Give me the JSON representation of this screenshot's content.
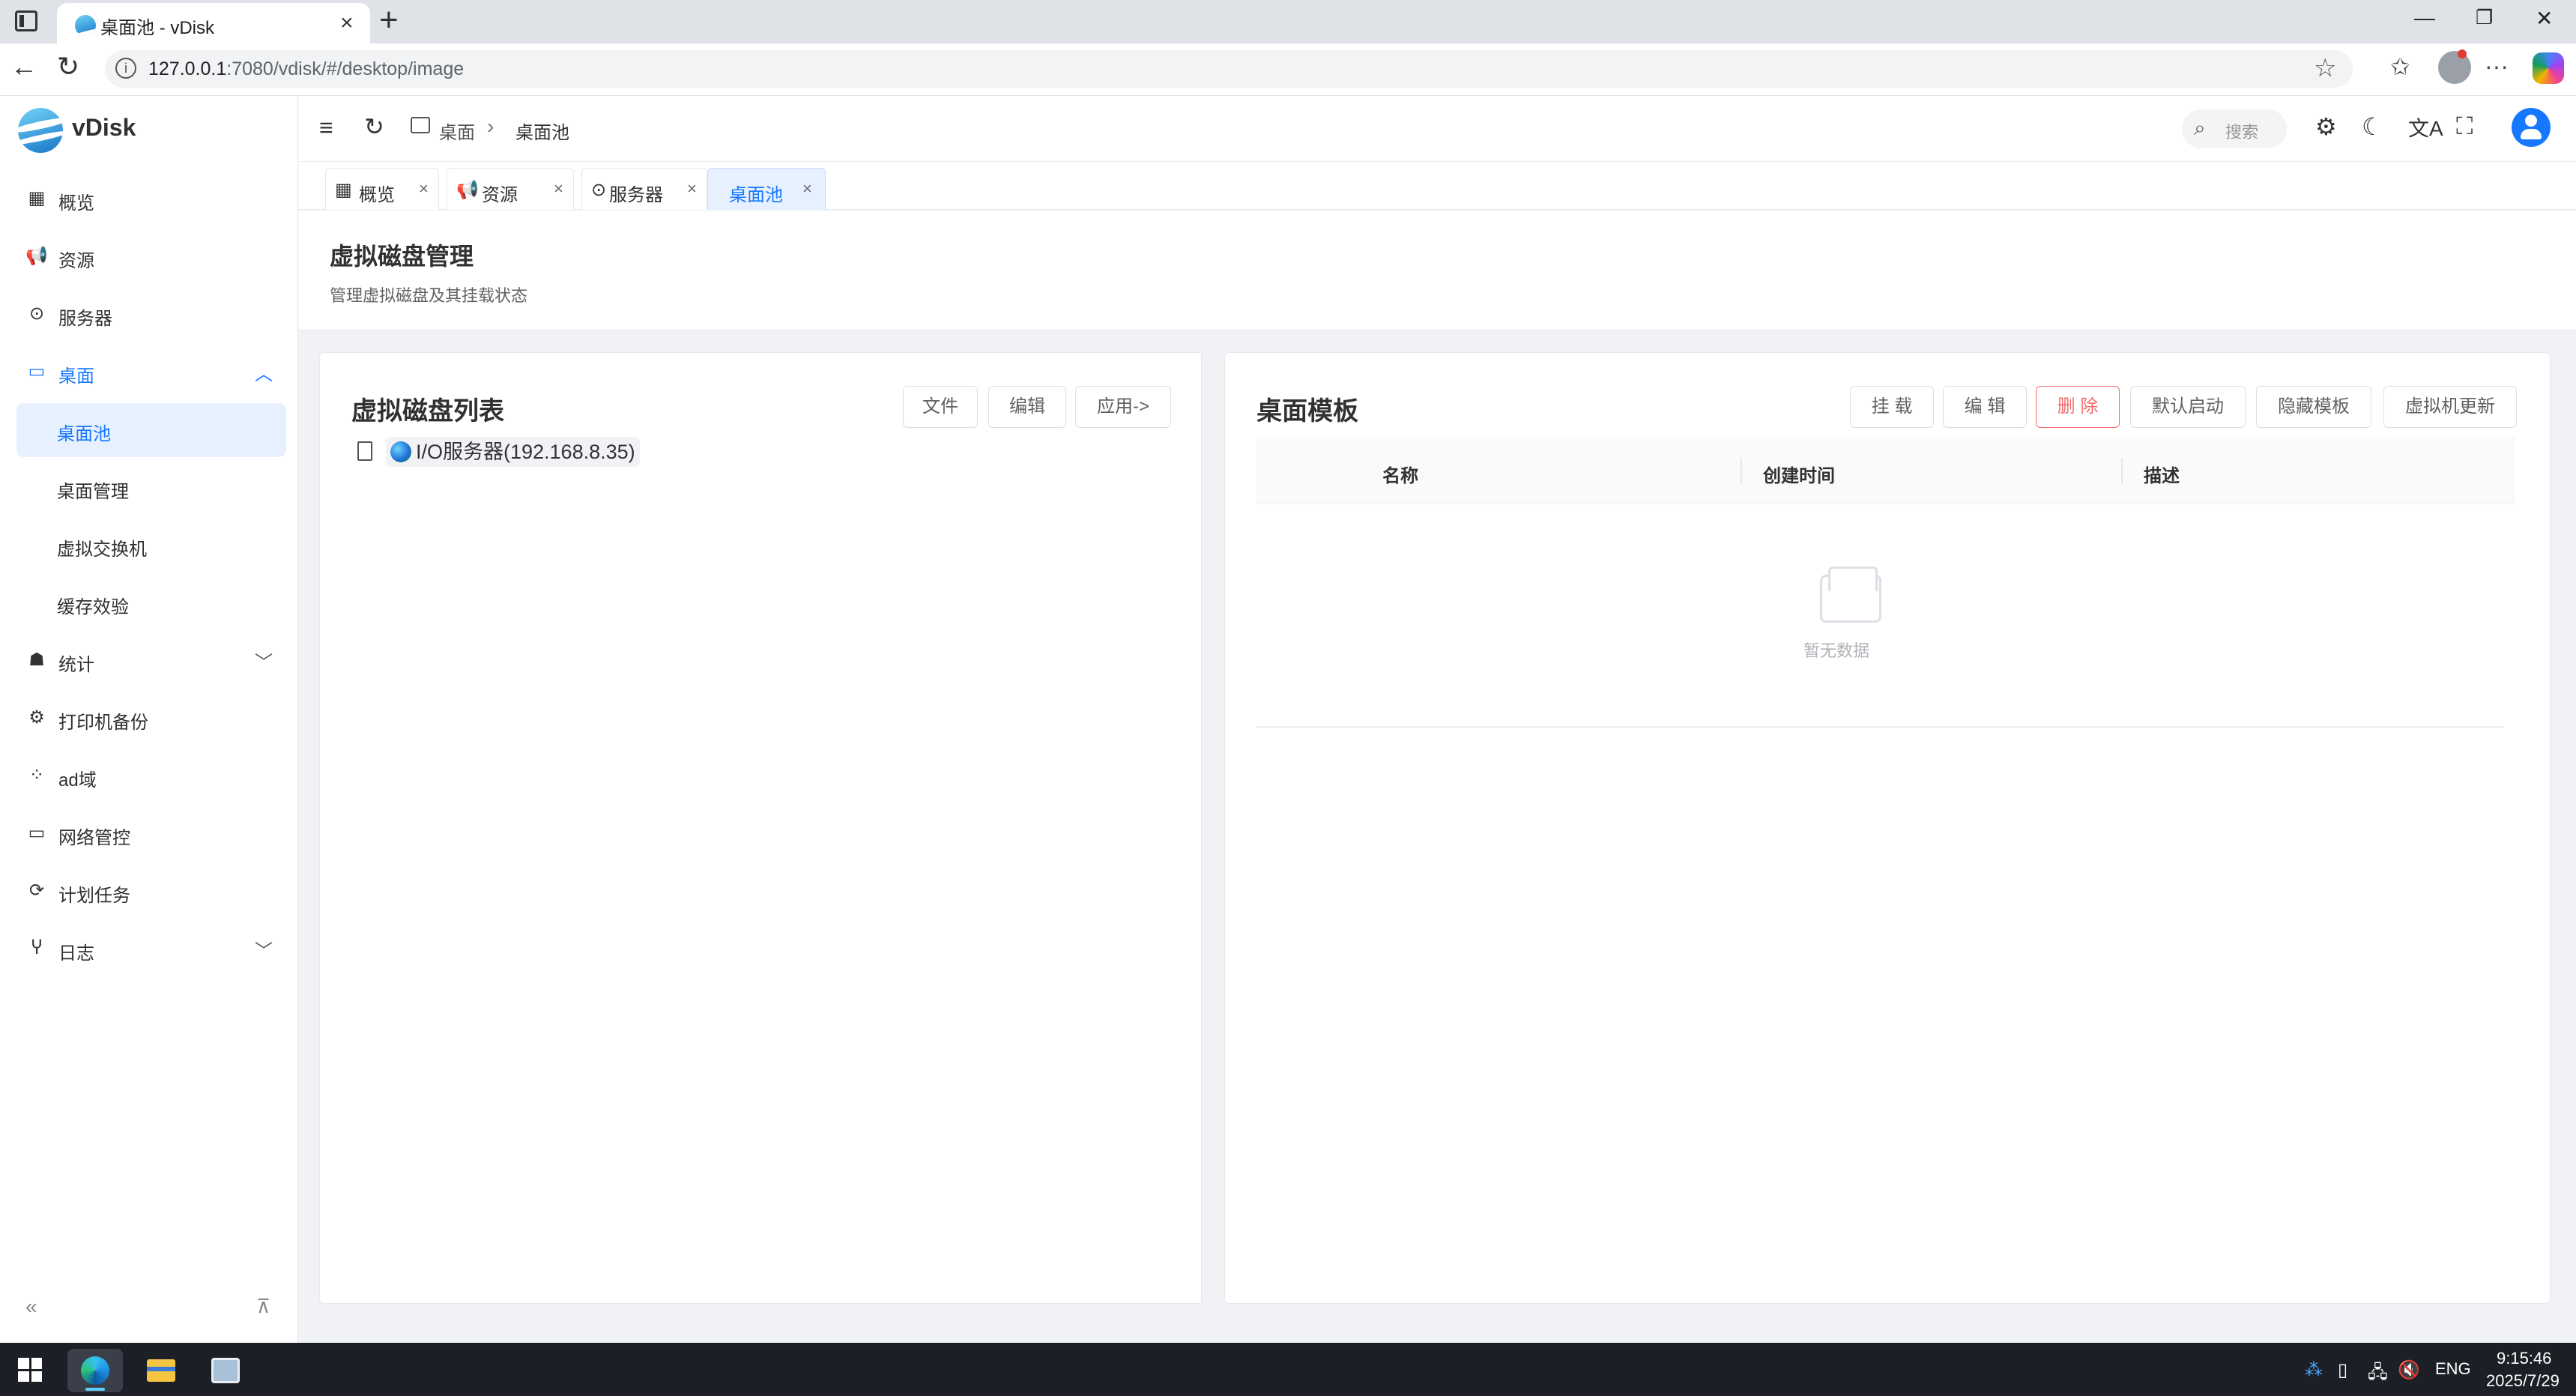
{
  "browser": {
    "tab_title": "桌面池 - vDisk",
    "url_host": "127.0.0.1",
    "url_rest": ":7080/vdisk/#/desktop/image"
  },
  "app": {
    "name": "vDisk"
  },
  "sidebar": {
    "items": [
      {
        "label": "概览",
        "icon": "grid-icon"
      },
      {
        "label": "资源",
        "icon": "megaphone-icon"
      },
      {
        "label": "服务器",
        "icon": "server-icon"
      },
      {
        "label": "桌面",
        "icon": "monitor-icon"
      },
      {
        "label": "桌面池"
      },
      {
        "label": "桌面管理"
      },
      {
        "label": "虚拟交换机"
      },
      {
        "label": "缓存效验"
      },
      {
        "label": "统计",
        "icon": "chart-icon"
      },
      {
        "label": "打印机备份",
        "icon": "gear-icon"
      },
      {
        "label": "ad域",
        "icon": "domain-icon"
      },
      {
        "label": "网络管控",
        "icon": "monitor-icon"
      },
      {
        "label": "计划任务",
        "icon": "task-icon"
      },
      {
        "label": "日志",
        "icon": "log-icon"
      }
    ],
    "footer_collapse": "«",
    "footer_pin": "⊼"
  },
  "topbar": {
    "breadcrumb": [
      "桌面",
      "桌面池"
    ],
    "search_placeholder": "搜索"
  },
  "tabs": [
    {
      "label": "概览",
      "icon": "grid-icon"
    },
    {
      "label": "资源",
      "icon": "megaphone-icon"
    },
    {
      "label": "服务器",
      "icon": "server-icon"
    },
    {
      "label": "桌面池"
    }
  ],
  "page": {
    "title": "虚拟磁盘管理",
    "subtitle": "管理虚拟磁盘及其挂载状态"
  },
  "left_panel": {
    "title": "虚拟磁盘列表",
    "buttons": [
      "文件",
      "编辑",
      "应用->"
    ],
    "tree": [
      {
        "label": "I/O服务器(192.168.8.35)",
        "icon": "globe-icon"
      }
    ]
  },
  "right_panel": {
    "title": "桌面模板",
    "buttons": [
      "挂 载",
      "编 辑",
      "删 除",
      "默认启动",
      "隐藏模板",
      "虚拟机更新"
    ],
    "columns": [
      "名称",
      "创建时间",
      "描述"
    ],
    "empty_text": "暂无数据"
  },
  "taskbar": {
    "tray_lang": "ENG",
    "time": "9:15:46",
    "date": "2025/7/29"
  },
  "colors": {
    "accent": "#1677ff",
    "danger": "#f56c6c"
  }
}
